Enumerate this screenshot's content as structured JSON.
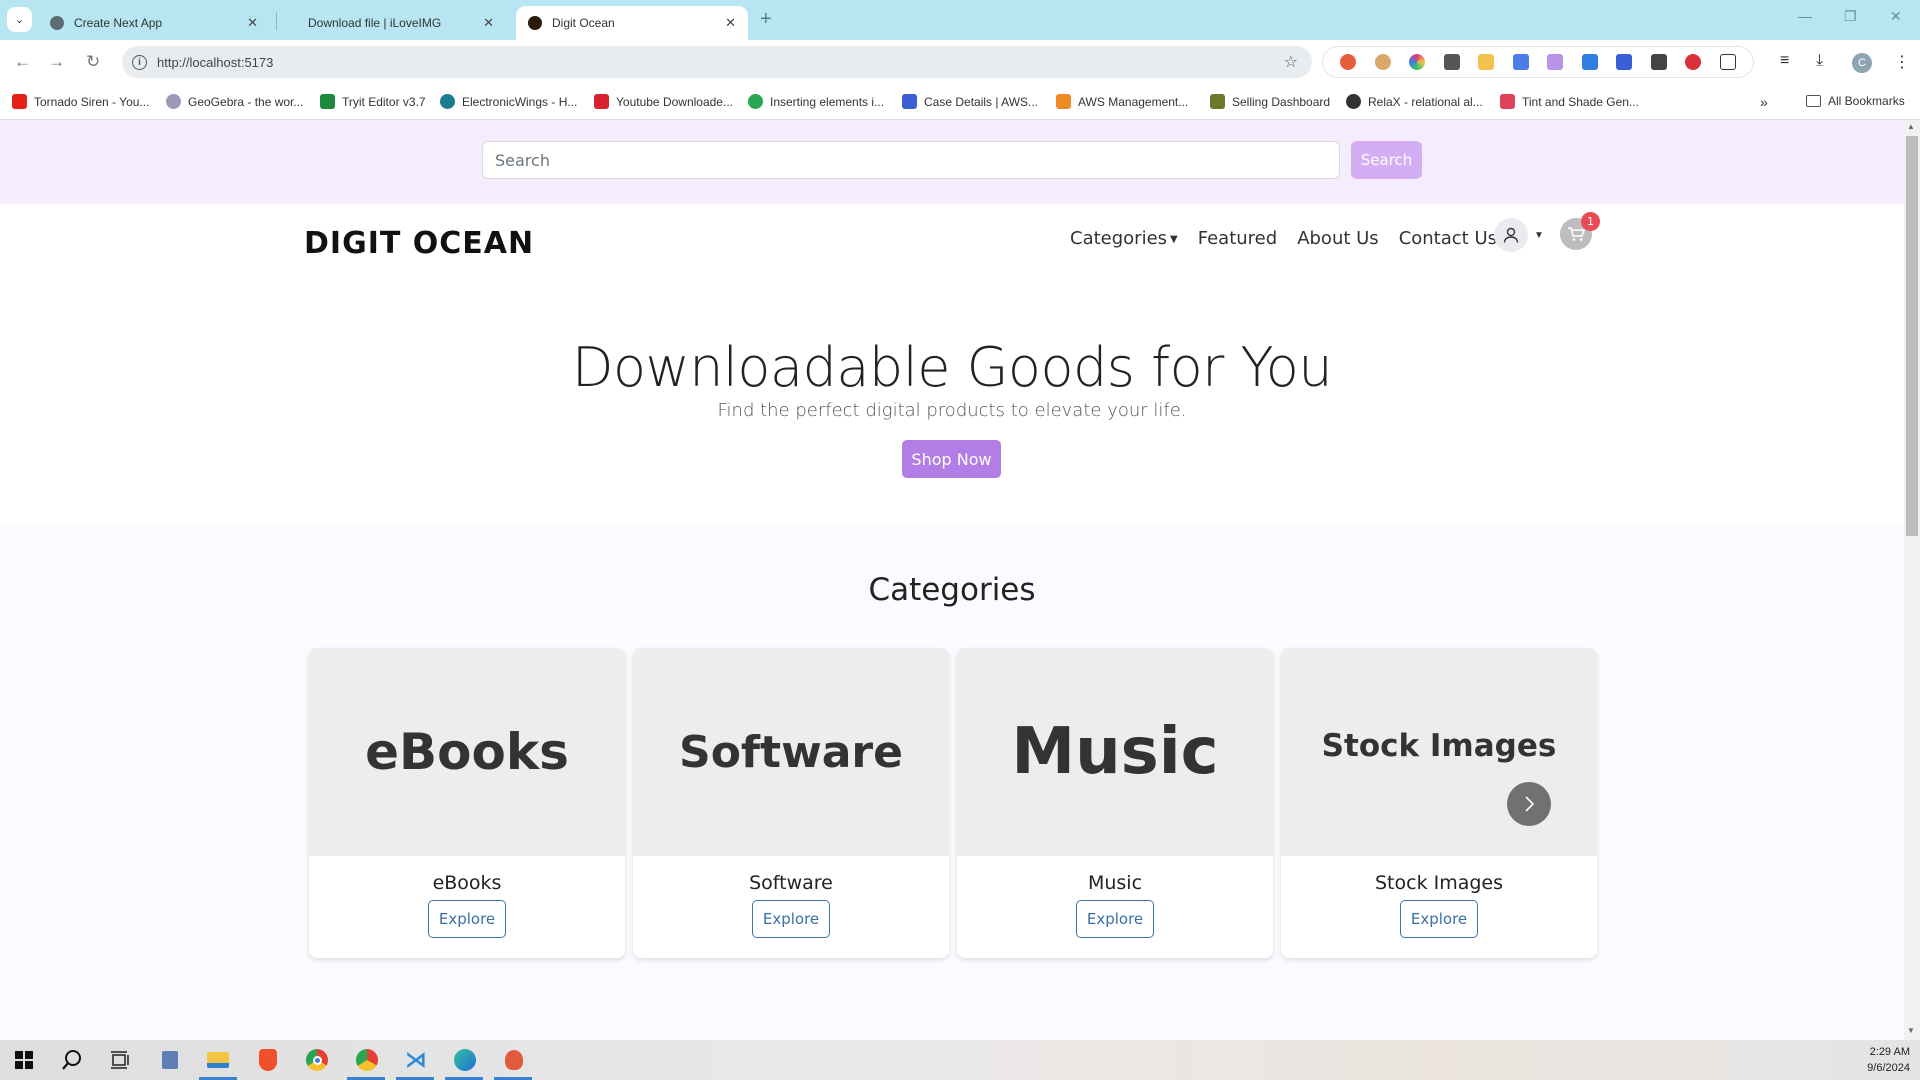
{
  "browser": {
    "tabs": [
      {
        "title": "Create Next App",
        "active": false,
        "icon_color": "#5f6b73"
      },
      {
        "title": "Download file | iLoveIMG",
        "active": false,
        "icon_color": ""
      },
      {
        "title": "Digit Ocean",
        "active": true,
        "icon_color": "#2a1a0a"
      }
    ],
    "tab_close_glyph": "✕",
    "new_tab_glyph": "+",
    "window_controls": {
      "minimize": "—",
      "restore": "❐",
      "close": "✕"
    },
    "url": "http://localhost:5173",
    "nav": {
      "back": "←",
      "forward": "→",
      "reload": "↻"
    },
    "extensions": [
      {
        "name": "extension-1",
        "color": "#e85d3c"
      },
      {
        "name": "extension-2",
        "color": "#d9a66b"
      },
      {
        "name": "color-wheel-extension",
        "color": "#e23c6a"
      },
      {
        "name": "extension-4",
        "color": "#555555"
      },
      {
        "name": "extension-5",
        "color": "#f2c24e"
      },
      {
        "name": "google-translate-extension",
        "color": "#4a7de8"
      },
      {
        "name": "extension-7",
        "color": "#b993e8"
      },
      {
        "name": "download-extension",
        "color": "#2f7ee0"
      },
      {
        "name": "sitemap-extension",
        "color": "#3a5fd6"
      },
      {
        "name": "extension-10",
        "color": "#444444"
      },
      {
        "name": "adblock-plus-extension",
        "color": "#d9303c"
      },
      {
        "name": "extensions-puzzle",
        "color": "#ffffff"
      }
    ],
    "profile_initial": "C",
    "bookmarks": [
      {
        "label": "Tornado Siren - You...",
        "color": "#e62117"
      },
      {
        "label": "GeoGebra - the wor...",
        "color": "#9a9ab8"
      },
      {
        "label": "Tryit Editor v3.7",
        "color": "#1c8a3a"
      },
      {
        "label": "ElectronicWings - H...",
        "color": "#1b7b8f"
      },
      {
        "label": "Youtube Downloade...",
        "color": "#d6232d"
      },
      {
        "label": "Inserting elements i...",
        "color": "#2aa652"
      },
      {
        "label": "Case Details | AWS...",
        "color": "#3c5fd6"
      },
      {
        "label": "AWS Management...",
        "color": "#f08a24"
      },
      {
        "label": "Selling Dashboard",
        "color": "#6a7a2a"
      },
      {
        "label": "RelaX - relational al...",
        "color": "#333333"
      },
      {
        "label": "Tint and Shade Gen...",
        "color": "#e0405a"
      }
    ],
    "bookmarks_overflow": "»",
    "all_bookmarks": "All Bookmarks"
  },
  "page": {
    "search": {
      "placeholder": "Search",
      "value": "",
      "button": "Search"
    },
    "brand": "DIGIT OCEAN",
    "nav": {
      "categories": "Categories",
      "featured": "Featured",
      "about": "About Us",
      "contact": "Contact Us"
    },
    "cart_count": "1",
    "hero": {
      "title": "Downloadable Goods for You",
      "subtitle": "Find the perfect digital products to elevate your life.",
      "cta": "Shop Now"
    },
    "categories_title": "Categories",
    "categories": [
      {
        "image_text": "eBooks",
        "name": "eBooks",
        "button": "Explore"
      },
      {
        "image_text": "Software",
        "name": "Software",
        "button": "Explore"
      },
      {
        "image_text": "Music",
        "name": "Music",
        "button": "Explore"
      },
      {
        "image_text": "Stock Images",
        "name": "Stock Images",
        "button": "Explore"
      }
    ],
    "colors": {
      "accent": "#b27ee6",
      "search_strip": "#f5ecfd",
      "badge": "#e94b55",
      "explore": "#3a6fa6"
    }
  },
  "taskbar": {
    "apps": [
      "start",
      "search",
      "task-view",
      "notepad",
      "file-explorer",
      "brave",
      "chrome",
      "chrome-profile",
      "vscode",
      "edge",
      "snipping-tool"
    ],
    "time": "2:29 AM",
    "date": "9/6/2024"
  }
}
